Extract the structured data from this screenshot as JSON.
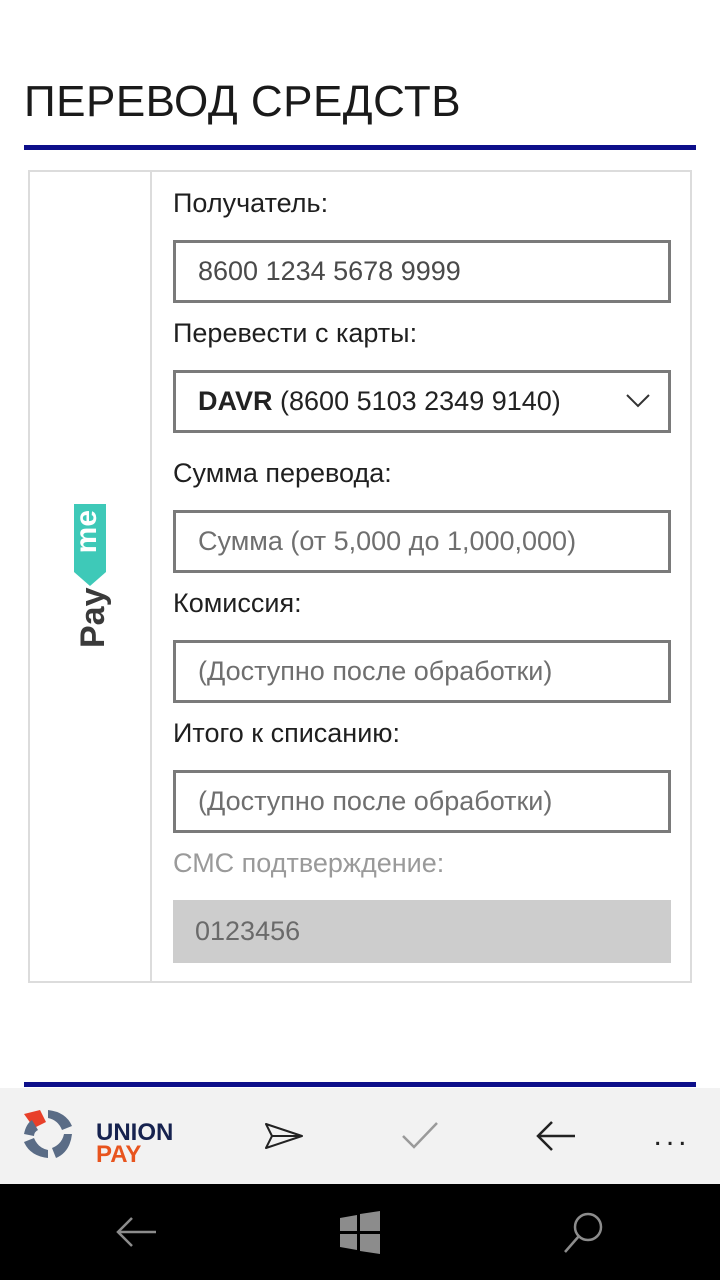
{
  "page": {
    "title": "ПЕРЕВОД СРЕДСТВ"
  },
  "brand": {
    "payme_logo": "Payme",
    "accent_color": "#0d0f8a",
    "payme_green": "#3ec9b8"
  },
  "form": {
    "recipient": {
      "label": "Получатель:",
      "value": "8600 1234 5678 9999"
    },
    "from_card": {
      "label": "Перевести с карты:",
      "bank": "DAVR",
      "card_number": "(8600 5103 2349 9140)"
    },
    "amount": {
      "label": "Сумма перевода:",
      "placeholder": "Сумма (от 5,000 до 1,000,000)"
    },
    "commission": {
      "label": "Комиссия:",
      "placeholder": "(Доступно после обработки)"
    },
    "total": {
      "label": "Итого к списанию:",
      "placeholder": "(Доступно после обработки)"
    },
    "sms": {
      "label": "СМС подтверждение:",
      "placeholder": "0123456"
    }
  },
  "appbar": {
    "logo_line1": "UNION",
    "logo_line2": "PAY",
    "send_icon": "send-icon",
    "accept_icon": "checkmark-icon",
    "back_icon": "back-arrow-icon",
    "more": "..."
  },
  "navbar": {
    "back_icon": "back-icon",
    "start_icon": "windows-icon",
    "search_icon": "search-icon"
  }
}
